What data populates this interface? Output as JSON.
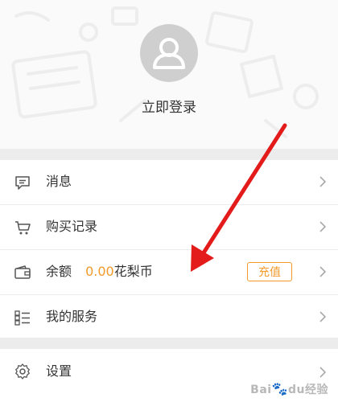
{
  "profile": {
    "login_text": "立即登录"
  },
  "menu": {
    "messages": {
      "label": "消息",
      "icon": "message-icon"
    },
    "purchases": {
      "label": "购买记录",
      "icon": "cart-icon"
    },
    "balance": {
      "label": "余额",
      "amount": "0.00",
      "unit": "花梨币",
      "recharge_label": "充值",
      "icon": "wallet-icon"
    },
    "services": {
      "label": "我的服务",
      "icon": "checklist-icon"
    },
    "settings": {
      "label": "设置",
      "icon": "gear-icon"
    }
  },
  "watermark": {
    "text_a": "Bai",
    "paw": "🐾",
    "text_b": "经验",
    "text_c": "du"
  },
  "colors": {
    "accent": "#f39a2b",
    "annotation_arrow": "#e31b1b"
  }
}
